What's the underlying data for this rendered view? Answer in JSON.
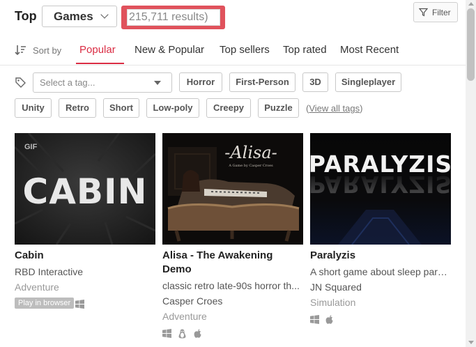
{
  "header": {
    "title": "Top",
    "category": "Games",
    "results": "215,711 results)",
    "filter_label": "Filter"
  },
  "sort": {
    "label": "Sort by",
    "tabs": [
      "Popular",
      "New & Popular",
      "Top sellers",
      "Top rated",
      "Most Recent"
    ],
    "active": "Popular"
  },
  "tags": {
    "placeholder": "Select a tag...",
    "items": [
      "Horror",
      "First-Person",
      "3D",
      "Singleplayer",
      "Unity",
      "Retro",
      "Short",
      "Low-poly",
      "Creepy",
      "Puzzle"
    ],
    "view_all_open": "(",
    "view_all": "View all tags",
    "view_all_close": ")"
  },
  "games": [
    {
      "thumb_text": "CABIN",
      "thumb_badge": "GIF",
      "title": "Cabin",
      "author": "RBD Interactive",
      "genre": "Adventure",
      "badge": "Play in browser",
      "platforms": [
        "windows-icon"
      ]
    },
    {
      "thumb_text": "-Alisa-",
      "thumb_sub": "A Game by Casper Croes",
      "title": "Alisa - The Awakening Demo",
      "description": "classic retro late-90s horror th...",
      "author": "Casper Croes",
      "genre": "Adventure",
      "platforms": [
        "windows-icon",
        "linux-icon",
        "apple-icon"
      ]
    },
    {
      "thumb_text": "PARALYZIS",
      "title": "Paralyzis",
      "description": "A short game about sleep paral...",
      "author": "JN Squared",
      "genre": "Simulation",
      "platforms": [
        "windows-icon",
        "apple-icon"
      ]
    }
  ],
  "colors": {
    "accent": "#da2c43",
    "highlight": "#e0525c"
  }
}
